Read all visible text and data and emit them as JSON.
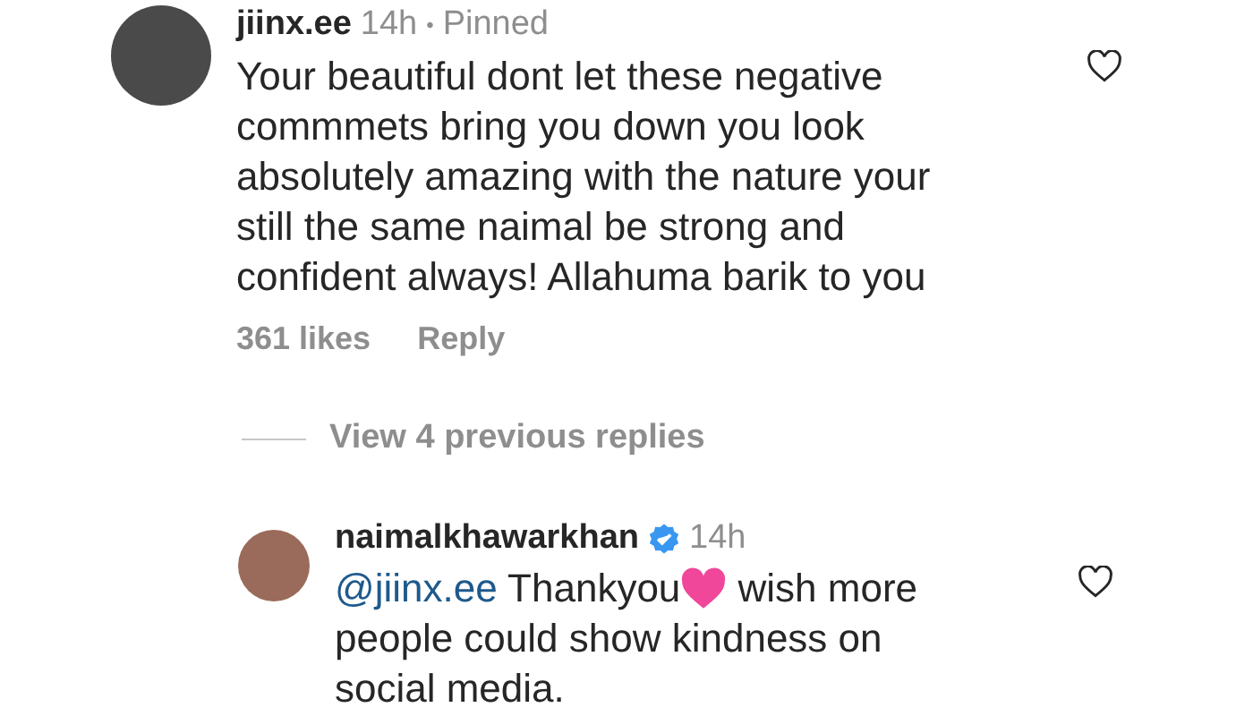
{
  "comment": {
    "username": "jiinx.ee",
    "time": "14h",
    "separator": "•",
    "pinned_label": "Pinned",
    "text": "Your beautiful dont let these negative commmets bring you down you look absolutely amazing with the nature your still the same naimal be strong and confident always! Allahuma barik to you",
    "likes": "361 likes",
    "reply_action": "Reply",
    "liked": false
  },
  "view_replies": "View 4 previous replies",
  "reply": {
    "username": "naimalkhawarkhan",
    "verified": true,
    "time": "14h",
    "mention": "@jiinx.ee",
    "text_before": "Thankyou",
    "text_after": "wish more people could show kindness on social media.",
    "liked": false
  }
}
